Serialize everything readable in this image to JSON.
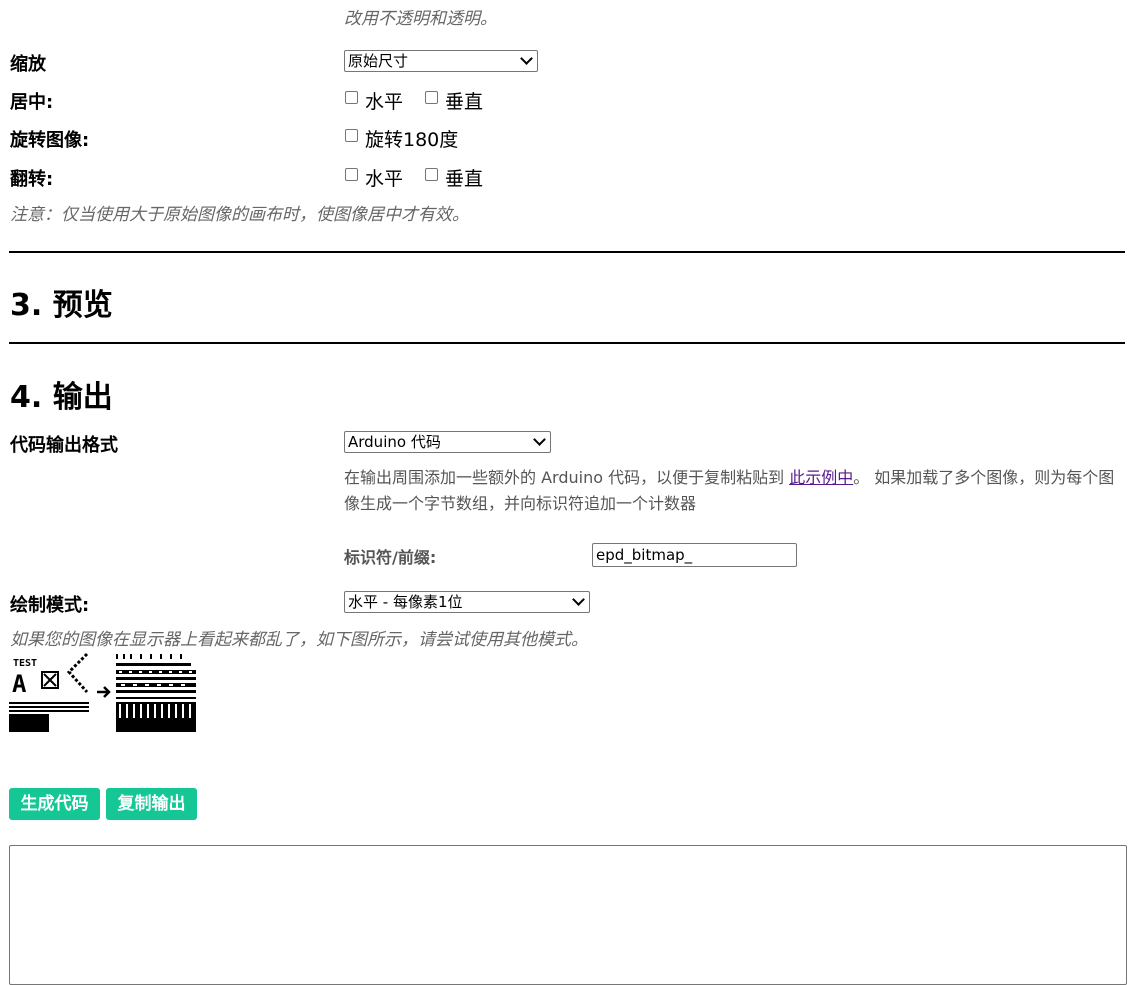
{
  "top_note": "改用不透明和透明。",
  "scaling": {
    "label": "缩放",
    "selected": "原始尺寸"
  },
  "center": {
    "label": "居中:",
    "horizontal": "水平",
    "vertical": "垂直"
  },
  "rotate": {
    "label": "旋转图像:",
    "option": "旋转180度"
  },
  "flip": {
    "label": "翻转:",
    "horizontal": "水平",
    "vertical": "垂直"
  },
  "center_note": "注意：仅当使用大于原始图像的画布时，使图像居中才有效。",
  "section3": {
    "title": "3. 预览"
  },
  "section4": {
    "title": "4. 输出"
  },
  "output_format": {
    "label": "代码输出格式",
    "selected": "Arduino 代码",
    "desc_before": "在输出周围添加一些额外的 Arduino 代码，以便于复制粘贴到 ",
    "link_text": "此示例中",
    "desc_after": "。 如果加载了多个图像，则为每个图像生成一个字节数组，并向标识符追加一个计数器"
  },
  "identifier": {
    "label": "标识符/前缀:",
    "value": "epd_bitmap_"
  },
  "draw_mode": {
    "label": "绘制模式:",
    "selected": "水平 - 每像素1位",
    "note": "如果您的图像在显示器上看起来都乱了，如下图所示，请尝试使用其他模式。"
  },
  "example_image": {
    "test_text": "TEST",
    "letter": "A"
  },
  "buttons": {
    "generate": "生成代码",
    "copy": "复制输出"
  },
  "colors": {
    "button_bg": "#14c795",
    "link": "#551a8b"
  }
}
